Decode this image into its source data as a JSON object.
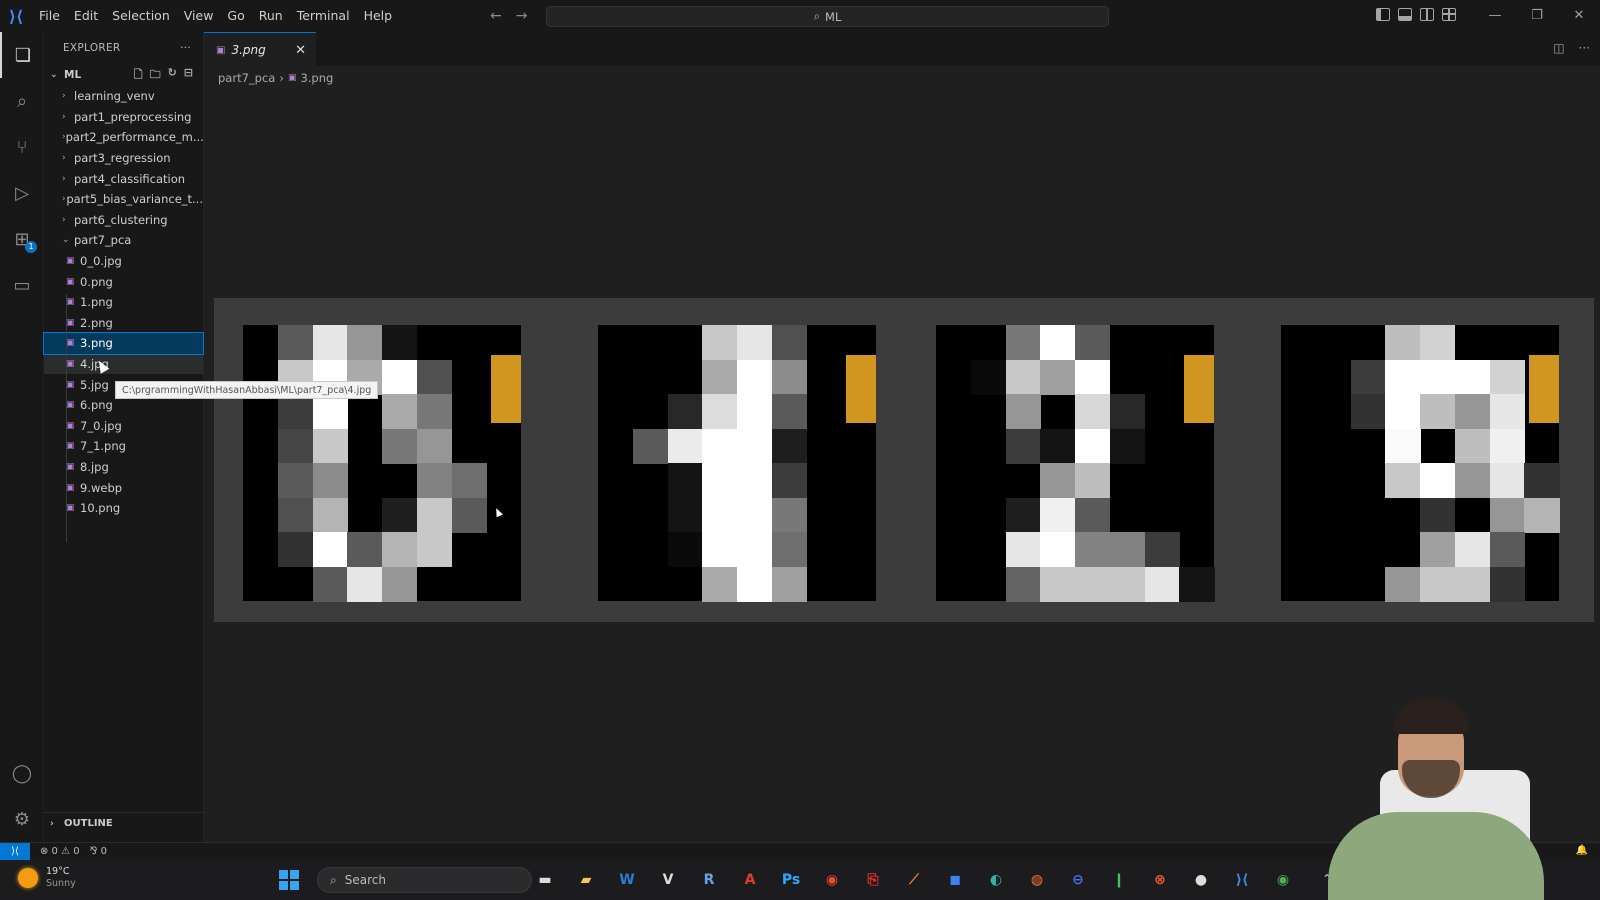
{
  "titlebar": {
    "menu": [
      "File",
      "Edit",
      "Selection",
      "View",
      "Go",
      "Run",
      "Terminal",
      "Help"
    ],
    "search_text": "ML"
  },
  "sidebar": {
    "header": "EXPLORER",
    "workspace": "ML",
    "folders_top": [
      "learning_venv",
      "part1_preprocessing",
      "part2_performance_m...",
      "part3_regression",
      "part4_classification",
      "part5_bias_variance_t...",
      "part6_clustering"
    ],
    "open_folder": "part7_pca",
    "files": [
      "0_0.jpg",
      "0.png",
      "1.png",
      "2.png",
      "3.png",
      "4.jpg",
      "5.jpg",
      "6.png",
      "7_0.jpg",
      "7_1.png",
      "8.jpg",
      "9.webp",
      "10.png"
    ],
    "selected_file": "3.png",
    "outline_label": "OUTLINE"
  },
  "tab": {
    "label": "3.png"
  },
  "breadcrumb": {
    "folder": "part7_pca",
    "file": "3.png"
  },
  "tooltip": "C:\\prgrammingWithHasanAbbasi\\ML\\part7_pca\\4.jpg",
  "statusbar": {
    "problems": "⊗ 0 ⚠ 0",
    "ports": "⅋ 0"
  },
  "taskbar": {
    "temperature": "19°C",
    "condition": "Sunny",
    "search_placeholder": "Search"
  }
}
